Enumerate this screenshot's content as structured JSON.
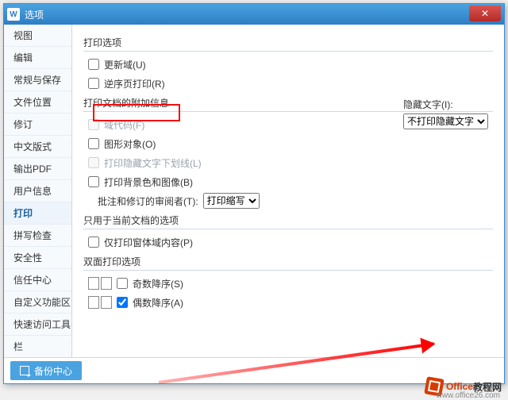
{
  "window": {
    "title": "选项",
    "close": "✕"
  },
  "sidebar": {
    "items": [
      {
        "label": "视图"
      },
      {
        "label": "编辑"
      },
      {
        "label": "常规与保存"
      },
      {
        "label": "文件位置"
      },
      {
        "label": "修订"
      },
      {
        "label": "中文版式"
      },
      {
        "label": "输出PDF"
      },
      {
        "label": "用户信息"
      },
      {
        "label": "打印",
        "selected": true
      },
      {
        "label": "拼写检查"
      },
      {
        "label": "安全性"
      },
      {
        "label": "信任中心"
      },
      {
        "label": "自定义功能区"
      },
      {
        "label": "快速访问工具栏"
      }
    ]
  },
  "groups": {
    "g1": {
      "title": "打印选项",
      "items": [
        {
          "label": "更新域(U)"
        },
        {
          "label": "逆序页打印(R)"
        }
      ]
    },
    "g2": {
      "title": "打印文档的附加信息",
      "items": [
        {
          "label": "域代码(F)",
          "disabled": true
        },
        {
          "label": "图形对象(O)",
          "highlight": true
        },
        {
          "label": "打印隐藏文字下划线(L)",
          "disabled": true
        },
        {
          "label": "打印背景色和图像(B)"
        }
      ],
      "reviewer": {
        "label": "批注和修订的审阅者(T):",
        "value": "打印缩写"
      },
      "hidden": {
        "label": "隐藏文字(I):",
        "value": "不打印隐藏文字"
      }
    },
    "g3": {
      "title": "只用于当前文档的选项",
      "items": [
        {
          "label": "仅打印窗体域内容(P)"
        }
      ]
    },
    "g4": {
      "title": "双面打印选项",
      "items": [
        {
          "label": "奇数降序(S)"
        },
        {
          "label": "偶数降序(A)",
          "checked": true
        }
      ]
    }
  },
  "footer": {
    "backup": "备份中心"
  },
  "watermark": {
    "t1": "Office",
    "t2": "教程网",
    "url": "www.office26.com"
  }
}
